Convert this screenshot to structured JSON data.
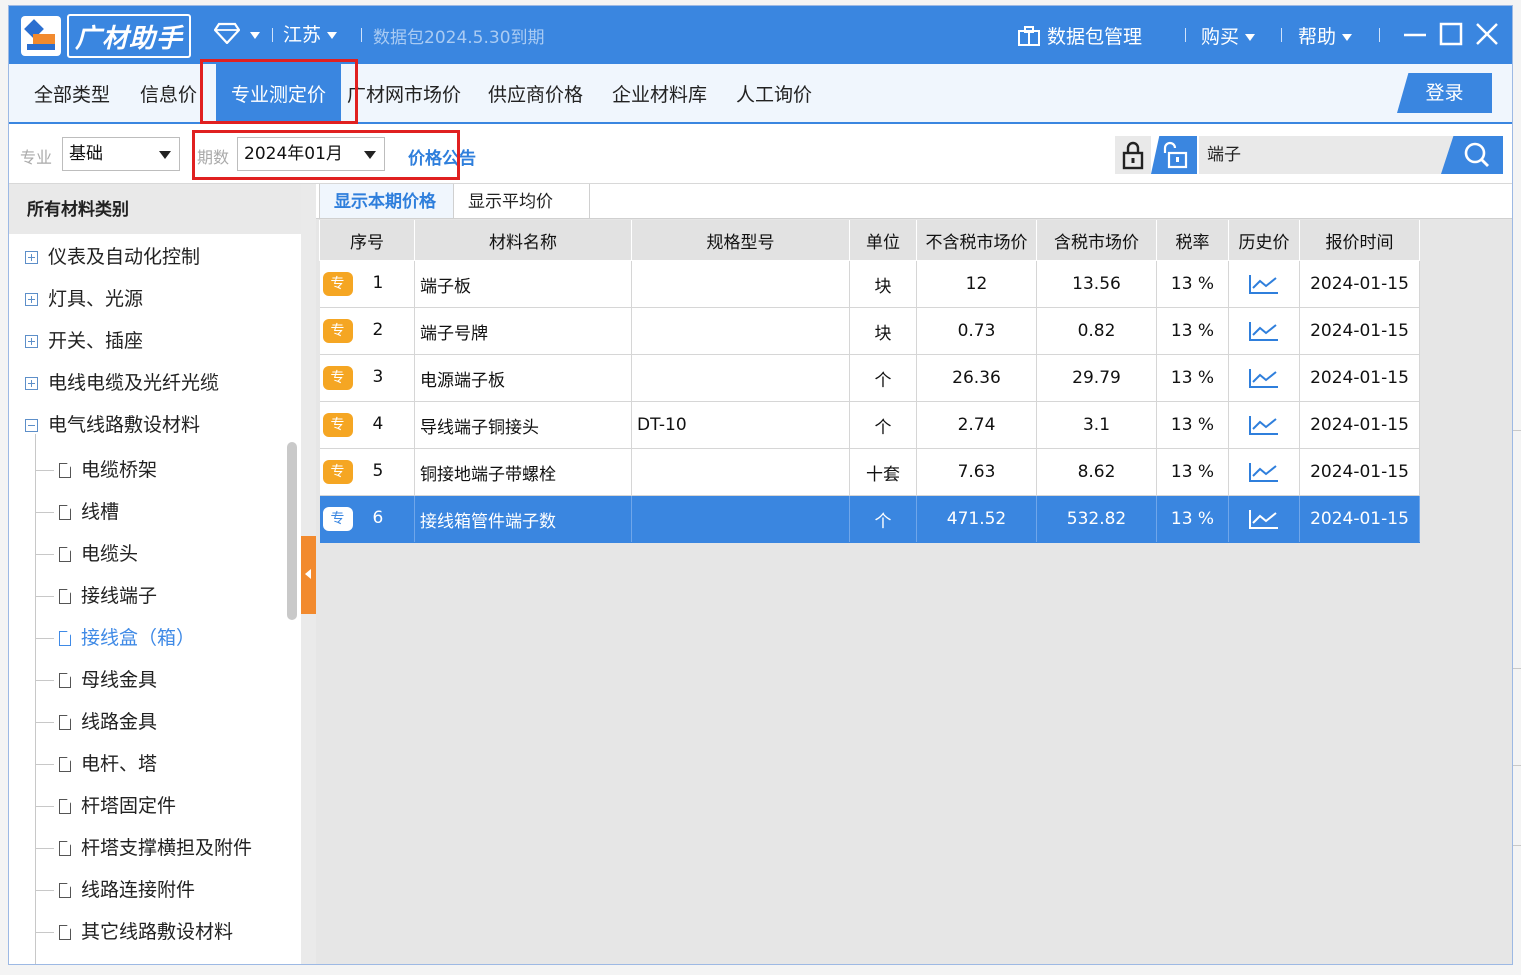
{
  "titlebar": {
    "app_name": "广材助手",
    "region": "江苏",
    "package_status": "数据包2024.5.30到期",
    "package_manage": "数据包管理",
    "buy": "购买",
    "help": "帮助"
  },
  "tabs": [
    "全部类型",
    "信息价",
    "专业测定价",
    "广材网市场价",
    "供应商价格",
    "企业材料库",
    "人工询价"
  ],
  "login_label": "登录",
  "filters": {
    "specialty_label": "专业",
    "specialty_value": "基础",
    "period_label": "期数",
    "period_value": "2024年01月",
    "price_notice": "价格公告",
    "search_value": "端子"
  },
  "left_panel": {
    "header": "所有材料类别",
    "categories": [
      {
        "label": "仪表及自动化控制"
      },
      {
        "label": "灯具、光源"
      },
      {
        "label": "开关、插座"
      },
      {
        "label": "电线电缆及光纤光缆"
      },
      {
        "label": "电气线路敷设材料"
      }
    ],
    "children": [
      {
        "label": "电缆桥架"
      },
      {
        "label": "线槽"
      },
      {
        "label": "电缆头"
      },
      {
        "label": "接线端子"
      },
      {
        "label": "接线盒（箱）"
      },
      {
        "label": "母线金具"
      },
      {
        "label": "线路金具"
      },
      {
        "label": "电杆、塔"
      },
      {
        "label": "杆塔固定件"
      },
      {
        "label": "杆塔支撑横担及附件"
      },
      {
        "label": "线路连接附件"
      },
      {
        "label": "其它线路敷设材料"
      }
    ]
  },
  "subtabs": [
    "显示本期价格",
    "显示平均价"
  ],
  "table": {
    "badge": "专",
    "columns": [
      "序号",
      "材料名称",
      "规格型号",
      "单位",
      "不含税市场价",
      "含税市场价",
      "税率",
      "历史价",
      "报价时间"
    ],
    "rows": [
      {
        "no": "1",
        "name": "端子板",
        "spec": "",
        "unit": "块",
        "price_ex": "12",
        "price_in": "13.56",
        "tax": "13 %",
        "date": "2024-01-15"
      },
      {
        "no": "2",
        "name": "端子号牌",
        "spec": "",
        "unit": "块",
        "price_ex": "0.73",
        "price_in": "0.82",
        "tax": "13 %",
        "date": "2024-01-15"
      },
      {
        "no": "3",
        "name": "电源端子板",
        "spec": "",
        "unit": "个",
        "price_ex": "26.36",
        "price_in": "29.79",
        "tax": "13 %",
        "date": "2024-01-15"
      },
      {
        "no": "4",
        "name": "导线端子铜接头",
        "spec": "DT-10",
        "unit": "个",
        "price_ex": "2.74",
        "price_in": "3.1",
        "tax": "13 %",
        "date": "2024-01-15"
      },
      {
        "no": "5",
        "name": "铜接地端子带螺栓",
        "spec": "",
        "unit": "十套",
        "price_ex": "7.63",
        "price_in": "8.62",
        "tax": "13 %",
        "date": "2024-01-15"
      },
      {
        "no": "6",
        "name": "接线箱管件端子数",
        "spec": "",
        "unit": "个",
        "price_ex": "471.52",
        "price_in": "532.82",
        "tax": "13 %",
        "date": "2024-01-15"
      }
    ]
  },
  "colors": {
    "primary": "#3a86e0",
    "badge": "#f5a623",
    "highlight_box": "#e02020",
    "handle": "#f28a2e"
  }
}
